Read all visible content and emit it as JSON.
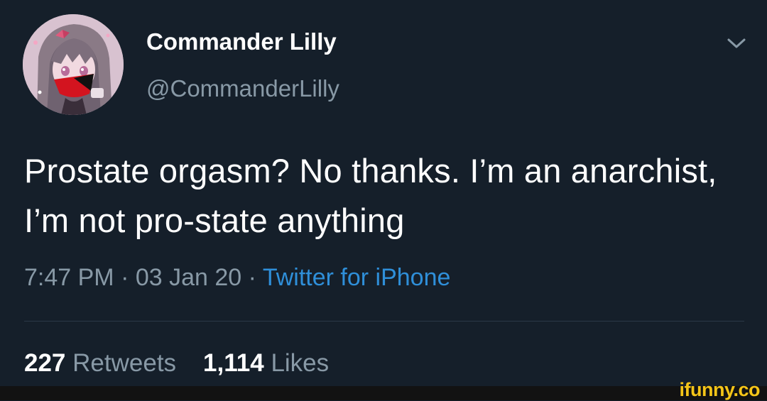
{
  "tweet": {
    "display_name": "Commander Lilly",
    "handle": "@CommanderLilly",
    "text": "Prostate orgasm? No thanks. I’m an anarchist, I’m not pro-state anything",
    "time": "7:47 PM",
    "separator": "·",
    "date": "03 Jan 20",
    "source": "Twitter for iPhone",
    "retweets_count": "227",
    "retweets_label": "Retweets",
    "likes_count": "1,114",
    "likes_label": "Likes"
  },
  "icons": {
    "avatar": "anime-character-avatar",
    "caret": "chevron-down-icon"
  },
  "colors": {
    "background": "#151f2a",
    "text_primary": "#ffffff",
    "text_secondary": "#8899a6",
    "link": "#2f8fd9",
    "watermark": "#f5c518"
  },
  "watermark": {
    "text": "ifunny.co"
  }
}
